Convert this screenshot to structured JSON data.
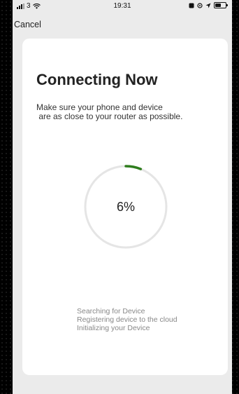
{
  "status_bar": {
    "carrier": "3",
    "time": "19:31",
    "battery_level": 0.55
  },
  "nav": {
    "cancel_label": "Cancel"
  },
  "content": {
    "title": "Connecting Now",
    "subtitle_lines": [
      "Make sure your phone and device",
      " are as close to your router as possible."
    ],
    "progress": {
      "value": 6,
      "label": "6%",
      "track_color": "#e5e5e5",
      "fill_color": "#2f7d1e"
    },
    "steps": [
      "Searching for Device",
      "Registering device to the cloud",
      "Initializing your Device"
    ]
  }
}
